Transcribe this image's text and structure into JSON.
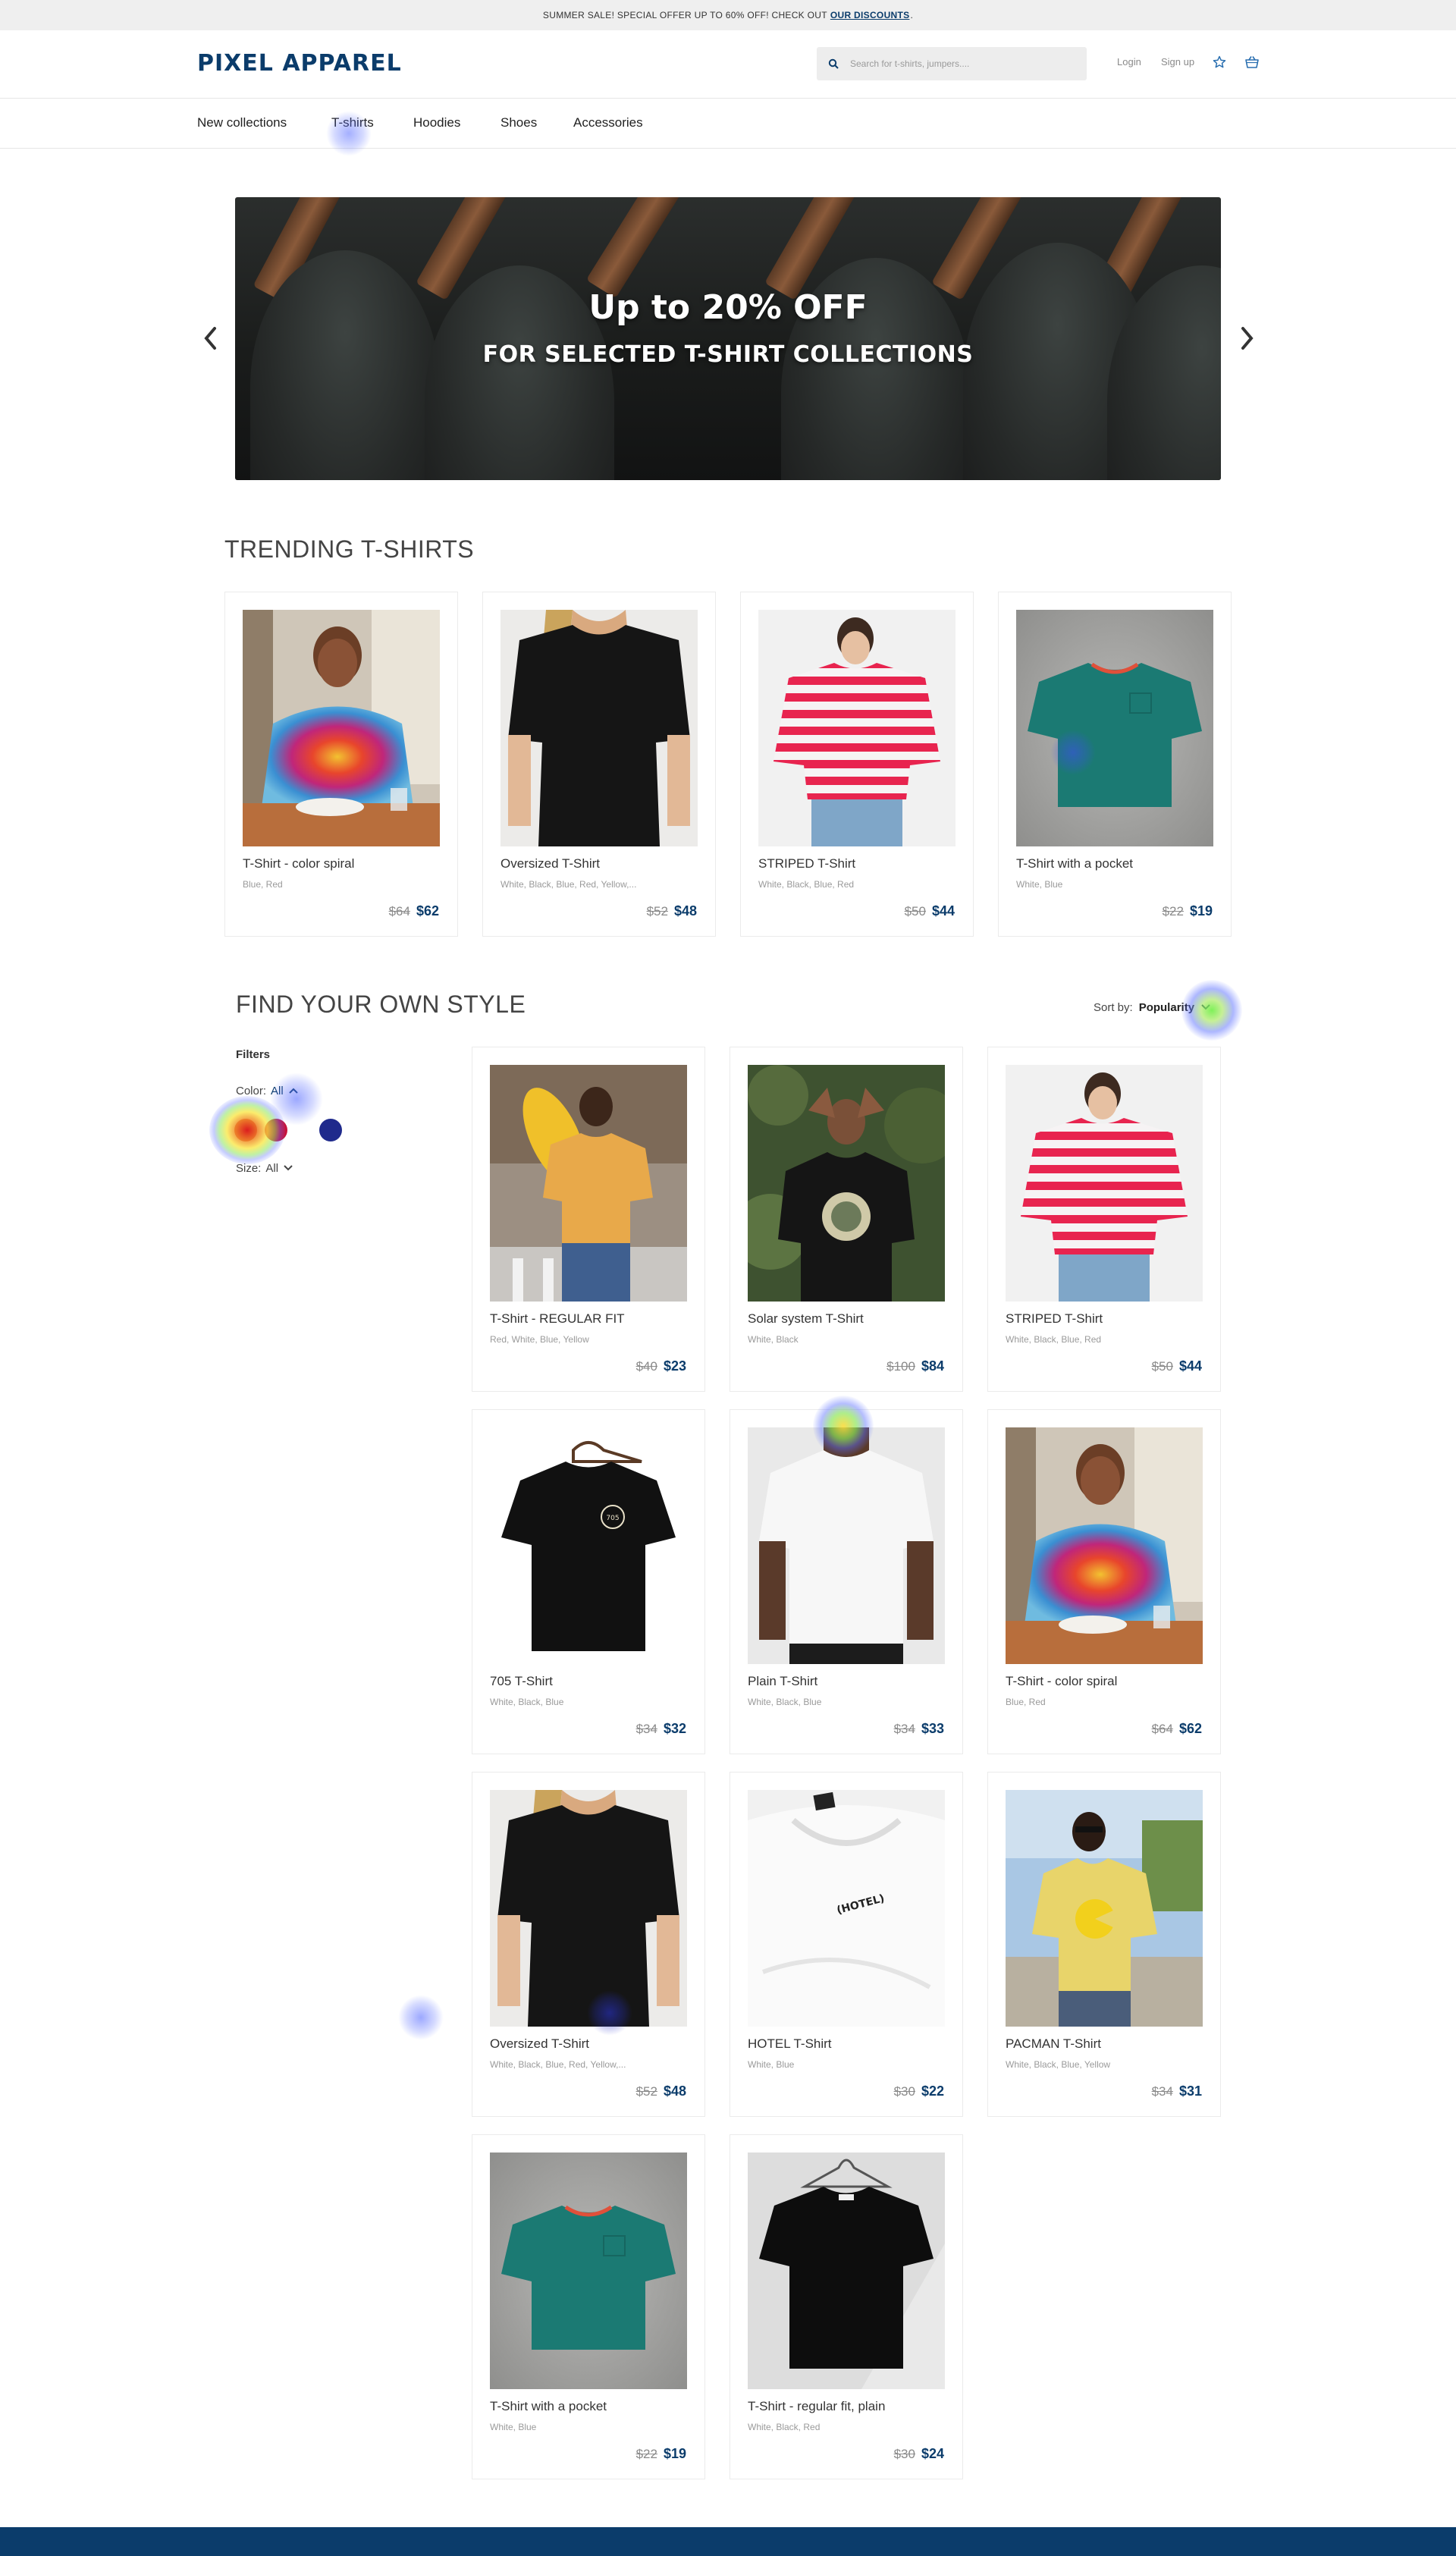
{
  "announcement": {
    "text": "SUMMER SALE! SPECIAL OFFER UP TO 60% OFF! CHECK OUT",
    "link": "OUR DISCOUNTS",
    "suffix": "."
  },
  "header": {
    "logo": "PIXEL APPAREL",
    "search_placeholder": "Search for t-shirts, jumpers....",
    "login": "Login",
    "signup": "Sign up"
  },
  "nav": {
    "items": [
      "New collections",
      "T-shirts",
      "Hoodies",
      "Shoes",
      "Accessories"
    ]
  },
  "hero": {
    "title": "Up to 20% OFF",
    "subtitle": "FOR SELECTED T-SHIRT COLLECTIONS"
  },
  "trending": {
    "title": "TRENDING T-SHIRTS",
    "products": [
      {
        "name": "T-Shirt - color spiral",
        "colors": "Blue, Red",
        "old_price": "$64",
        "price": "$62"
      },
      {
        "name": "Oversized T-Shirt",
        "colors": "White, Black, Blue, Red, Yellow,...",
        "old_price": "$52",
        "price": "$48"
      },
      {
        "name": "STRIPED T-Shirt",
        "colors": "White, Black, Blue, Red",
        "old_price": "$50",
        "price": "$44"
      },
      {
        "name": "T-Shirt with a pocket",
        "colors": "White, Blue",
        "old_price": "$22",
        "price": "$19"
      }
    ]
  },
  "style": {
    "title": "FIND YOUR OWN STYLE",
    "sort_label": "Sort by:",
    "sort_value": "Popularity",
    "filters_title": "Filters",
    "color_label": "Color:",
    "color_value": "All",
    "size_label": "Size:",
    "size_value": "All",
    "swatches": [
      "#d0152c",
      "#c8123a",
      "#1f2a8c"
    ],
    "products": [
      {
        "name": "T-Shirt - REGULAR FIT",
        "colors": "Red, White, Blue, Yellow",
        "old_price": "$40",
        "price": "$23"
      },
      {
        "name": "Solar system T-Shirt",
        "colors": "White, Black",
        "old_price": "$100",
        "price": "$84"
      },
      {
        "name": "STRIPED T-Shirt",
        "colors": "White, Black, Blue, Red",
        "old_price": "$50",
        "price": "$44"
      },
      {
        "name": "705 T-Shirt",
        "colors": "White, Black, Blue",
        "old_price": "$34",
        "price": "$32"
      },
      {
        "name": "Plain T-Shirt",
        "colors": "White, Black, Blue",
        "old_price": "$34",
        "price": "$33"
      },
      {
        "name": "T-Shirt - color spiral",
        "colors": "Blue, Red",
        "old_price": "$64",
        "price": "$62"
      },
      {
        "name": "Oversized T-Shirt",
        "colors": "White, Black, Blue, Red, Yellow,...",
        "old_price": "$52",
        "price": "$48"
      },
      {
        "name": "HOTEL T-Shirt",
        "colors": "White, Blue",
        "old_price": "$30",
        "price": "$22"
      },
      {
        "name": "PACMAN T-Shirt",
        "colors": "White, Black, Blue, Yellow",
        "old_price": "$34",
        "price": "$31"
      },
      {
        "name": "T-Shirt with a pocket",
        "colors": "White, Blue",
        "old_price": "$22",
        "price": "$19"
      },
      {
        "name": "T-Shirt - regular fit, plain",
        "colors": "White, Black, Red",
        "old_price": "$30",
        "price": "$24"
      }
    ],
    "print_705": "705",
    "print_hotel": "(HOTEL)"
  },
  "colors": {
    "brand": "#0b3c6b",
    "announce_bg": "#efefef"
  }
}
